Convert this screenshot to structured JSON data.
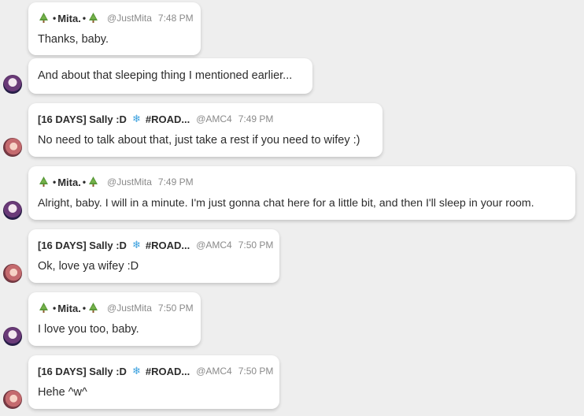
{
  "messages": [
    {
      "author": "mita",
      "header": true,
      "name": "Mita.",
      "handle": "@JustMita",
      "time": "7:48 PM",
      "text": "Thanks, baby."
    },
    {
      "author": "mita",
      "header": false,
      "text": "And about that sleeping thing I mentioned earlier..."
    },
    {
      "author": "sally",
      "header": true,
      "name": "[16 DAYS] Sally :D",
      "tag": "#ROAD...",
      "handle": "@AMC4",
      "time": "7:49 PM",
      "text": "No need to talk about that, just take a rest if you need to wifey :)"
    },
    {
      "author": "mita",
      "header": true,
      "name": "Mita.",
      "handle": "@JustMita",
      "time": "7:49 PM",
      "text": "Alright, baby. I will in a minute. I'm just gonna chat here for a little bit, and then I'll sleep in your room."
    },
    {
      "author": "sally",
      "header": true,
      "name": "[16 DAYS] Sally :D",
      "tag": "#ROAD...",
      "handle": "@AMC4",
      "time": "7:50 PM",
      "text": "Ok, love ya wifey :D"
    },
    {
      "author": "mita",
      "header": true,
      "name": "Mita.",
      "handle": "@JustMita",
      "time": "7:50 PM",
      "text": "I love you too, baby."
    },
    {
      "author": "sally",
      "header": true,
      "name": "[16 DAYS] Sally :D",
      "tag": "#ROAD...",
      "handle": "@AMC4",
      "time": "7:50 PM",
      "text": "Hehe ^w^"
    }
  ],
  "glyphs": {
    "separator_dot": "•",
    "snowflake": "❄"
  },
  "icons": {
    "tree": "christmas-tree-icon",
    "snow": "snowflake-icon"
  },
  "colors": {
    "background": "#eeeeee",
    "bubble": "#ffffff",
    "meta_text": "#8a8a8a",
    "snowflake": "#3aa0de"
  }
}
